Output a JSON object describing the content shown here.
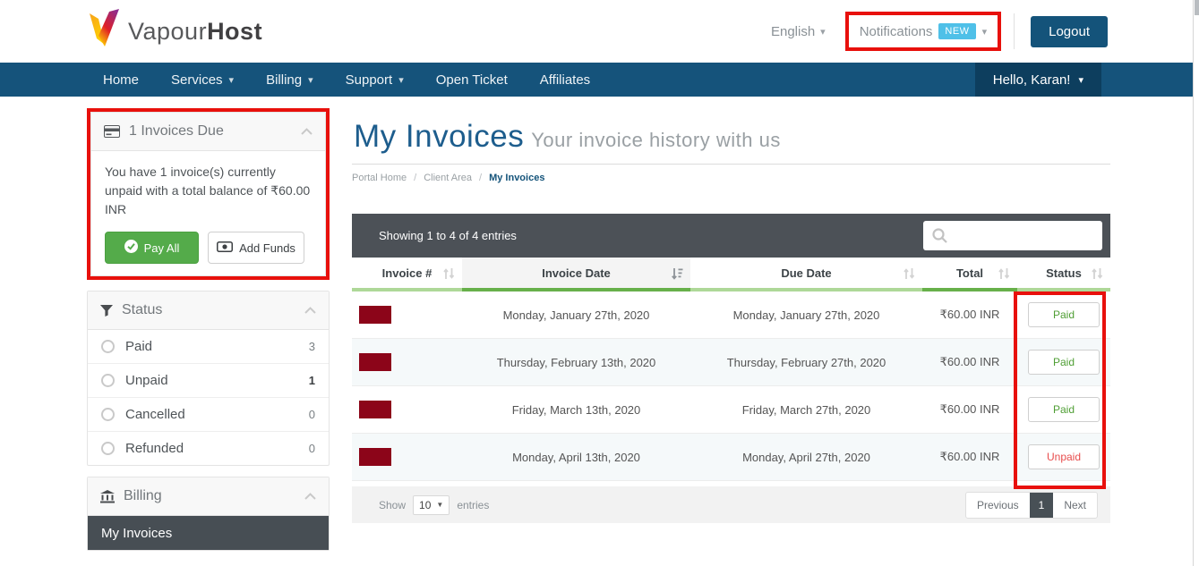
{
  "header": {
    "brand_regular": "Vapour",
    "brand_bold": "Host",
    "language_label": "English",
    "notifications_label": "Notifications",
    "new_badge": "NEW",
    "logout_label": "Logout"
  },
  "navbar": {
    "items": [
      {
        "label": "Home",
        "has_caret": false
      },
      {
        "label": "Services",
        "has_caret": true
      },
      {
        "label": "Billing",
        "has_caret": true
      },
      {
        "label": "Support",
        "has_caret": true
      },
      {
        "label": "Open Ticket",
        "has_caret": false
      },
      {
        "label": "Affiliates",
        "has_caret": false
      }
    ],
    "user_menu_label": "Hello, Karan!"
  },
  "sidebar": {
    "invoices_due": {
      "title": "1 Invoices Due",
      "message": "You have 1 invoice(s) currently unpaid with a total balance of ₹60.00 INR",
      "pay_all_label": "Pay All",
      "add_funds_label": "Add Funds"
    },
    "status_filter": {
      "title": "Status",
      "items": [
        {
          "label": "Paid",
          "count": "3"
        },
        {
          "label": "Unpaid",
          "count": "1"
        },
        {
          "label": "Cancelled",
          "count": "0"
        },
        {
          "label": "Refunded",
          "count": "0"
        }
      ]
    },
    "billing": {
      "title": "Billing",
      "active_item": "My Invoices"
    }
  },
  "main": {
    "page_title": "My Invoices",
    "page_subtitle": "Your invoice history with us",
    "breadcrumb": [
      "Portal Home",
      "Client Area",
      "My Invoices"
    ],
    "table": {
      "summary": "Showing 1 to 4 of 4 entries",
      "search_placeholder": "",
      "columns": [
        "Invoice #",
        "Invoice Date",
        "Due Date",
        "Total",
        "Status"
      ],
      "rows": [
        {
          "invoice_number": "[redacted]",
          "invoice_date": "Monday, January 27th, 2020",
          "due_date": "Monday, January 27th, 2020",
          "total": "₹60.00 INR",
          "status": "Paid"
        },
        {
          "invoice_number": "[redacted]",
          "invoice_date": "Thursday, February 13th, 2020",
          "due_date": "Thursday, February 27th, 2020",
          "total": "₹60.00 INR",
          "status": "Paid"
        },
        {
          "invoice_number": "[redacted]",
          "invoice_date": "Friday, March 13th, 2020",
          "due_date": "Friday, March 27th, 2020",
          "total": "₹60.00 INR",
          "status": "Paid"
        },
        {
          "invoice_number": "[redacted]",
          "invoice_date": "Monday, April 13th, 2020",
          "due_date": "Monday, April 27th, 2020",
          "total": "₹60.00 INR",
          "status": "Unpaid"
        }
      ],
      "footer": {
        "show_label": "Show",
        "page_size": "10",
        "entries_label": "entries",
        "previous_label": "Previous",
        "current_page": "1",
        "next_label": "Next"
      }
    }
  },
  "colors": {
    "annotation_red": "#e8100c",
    "navbar_blue": "#15537b",
    "user_menu_blue": "#0d3e5e",
    "new_badge_blue": "#4fc0e8",
    "pay_all_green": "#54ab4a",
    "paid_green": "#4e9e33",
    "unpaid_red": "#e84c4c",
    "redaction_maroon": "#8c0519",
    "toolbar_gray": "#4c5157",
    "title_blue": "#1d5d8d"
  }
}
